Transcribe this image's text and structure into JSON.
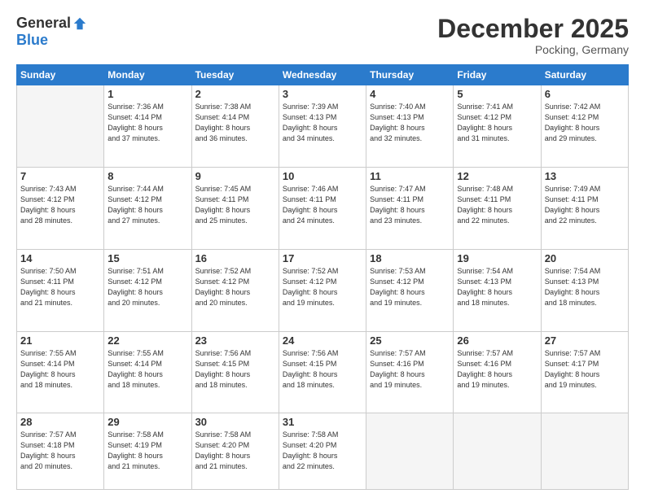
{
  "header": {
    "logo_general": "General",
    "logo_blue": "Blue",
    "month_title": "December 2025",
    "location": "Pocking, Germany"
  },
  "days_of_week": [
    "Sunday",
    "Monday",
    "Tuesday",
    "Wednesday",
    "Thursday",
    "Friday",
    "Saturday"
  ],
  "weeks": [
    [
      {
        "day": "",
        "info": ""
      },
      {
        "day": "1",
        "info": "Sunrise: 7:36 AM\nSunset: 4:14 PM\nDaylight: 8 hours\nand 37 minutes."
      },
      {
        "day": "2",
        "info": "Sunrise: 7:38 AM\nSunset: 4:14 PM\nDaylight: 8 hours\nand 36 minutes."
      },
      {
        "day": "3",
        "info": "Sunrise: 7:39 AM\nSunset: 4:13 PM\nDaylight: 8 hours\nand 34 minutes."
      },
      {
        "day": "4",
        "info": "Sunrise: 7:40 AM\nSunset: 4:13 PM\nDaylight: 8 hours\nand 32 minutes."
      },
      {
        "day": "5",
        "info": "Sunrise: 7:41 AM\nSunset: 4:12 PM\nDaylight: 8 hours\nand 31 minutes."
      },
      {
        "day": "6",
        "info": "Sunrise: 7:42 AM\nSunset: 4:12 PM\nDaylight: 8 hours\nand 29 minutes."
      }
    ],
    [
      {
        "day": "7",
        "info": "Sunrise: 7:43 AM\nSunset: 4:12 PM\nDaylight: 8 hours\nand 28 minutes."
      },
      {
        "day": "8",
        "info": "Sunrise: 7:44 AM\nSunset: 4:12 PM\nDaylight: 8 hours\nand 27 minutes."
      },
      {
        "day": "9",
        "info": "Sunrise: 7:45 AM\nSunset: 4:11 PM\nDaylight: 8 hours\nand 25 minutes."
      },
      {
        "day": "10",
        "info": "Sunrise: 7:46 AM\nSunset: 4:11 PM\nDaylight: 8 hours\nand 24 minutes."
      },
      {
        "day": "11",
        "info": "Sunrise: 7:47 AM\nSunset: 4:11 PM\nDaylight: 8 hours\nand 23 minutes."
      },
      {
        "day": "12",
        "info": "Sunrise: 7:48 AM\nSunset: 4:11 PM\nDaylight: 8 hours\nand 22 minutes."
      },
      {
        "day": "13",
        "info": "Sunrise: 7:49 AM\nSunset: 4:11 PM\nDaylight: 8 hours\nand 22 minutes."
      }
    ],
    [
      {
        "day": "14",
        "info": "Sunrise: 7:50 AM\nSunset: 4:11 PM\nDaylight: 8 hours\nand 21 minutes."
      },
      {
        "day": "15",
        "info": "Sunrise: 7:51 AM\nSunset: 4:12 PM\nDaylight: 8 hours\nand 20 minutes."
      },
      {
        "day": "16",
        "info": "Sunrise: 7:52 AM\nSunset: 4:12 PM\nDaylight: 8 hours\nand 20 minutes."
      },
      {
        "day": "17",
        "info": "Sunrise: 7:52 AM\nSunset: 4:12 PM\nDaylight: 8 hours\nand 19 minutes."
      },
      {
        "day": "18",
        "info": "Sunrise: 7:53 AM\nSunset: 4:12 PM\nDaylight: 8 hours\nand 19 minutes."
      },
      {
        "day": "19",
        "info": "Sunrise: 7:54 AM\nSunset: 4:13 PM\nDaylight: 8 hours\nand 18 minutes."
      },
      {
        "day": "20",
        "info": "Sunrise: 7:54 AM\nSunset: 4:13 PM\nDaylight: 8 hours\nand 18 minutes."
      }
    ],
    [
      {
        "day": "21",
        "info": "Sunrise: 7:55 AM\nSunset: 4:14 PM\nDaylight: 8 hours\nand 18 minutes."
      },
      {
        "day": "22",
        "info": "Sunrise: 7:55 AM\nSunset: 4:14 PM\nDaylight: 8 hours\nand 18 minutes."
      },
      {
        "day": "23",
        "info": "Sunrise: 7:56 AM\nSunset: 4:15 PM\nDaylight: 8 hours\nand 18 minutes."
      },
      {
        "day": "24",
        "info": "Sunrise: 7:56 AM\nSunset: 4:15 PM\nDaylight: 8 hours\nand 18 minutes."
      },
      {
        "day": "25",
        "info": "Sunrise: 7:57 AM\nSunset: 4:16 PM\nDaylight: 8 hours\nand 19 minutes."
      },
      {
        "day": "26",
        "info": "Sunrise: 7:57 AM\nSunset: 4:16 PM\nDaylight: 8 hours\nand 19 minutes."
      },
      {
        "day": "27",
        "info": "Sunrise: 7:57 AM\nSunset: 4:17 PM\nDaylight: 8 hours\nand 19 minutes."
      }
    ],
    [
      {
        "day": "28",
        "info": "Sunrise: 7:57 AM\nSunset: 4:18 PM\nDaylight: 8 hours\nand 20 minutes."
      },
      {
        "day": "29",
        "info": "Sunrise: 7:58 AM\nSunset: 4:19 PM\nDaylight: 8 hours\nand 21 minutes."
      },
      {
        "day": "30",
        "info": "Sunrise: 7:58 AM\nSunset: 4:20 PM\nDaylight: 8 hours\nand 21 minutes."
      },
      {
        "day": "31",
        "info": "Sunrise: 7:58 AM\nSunset: 4:20 PM\nDaylight: 8 hours\nand 22 minutes."
      },
      {
        "day": "",
        "info": ""
      },
      {
        "day": "",
        "info": ""
      },
      {
        "day": "",
        "info": ""
      }
    ]
  ]
}
